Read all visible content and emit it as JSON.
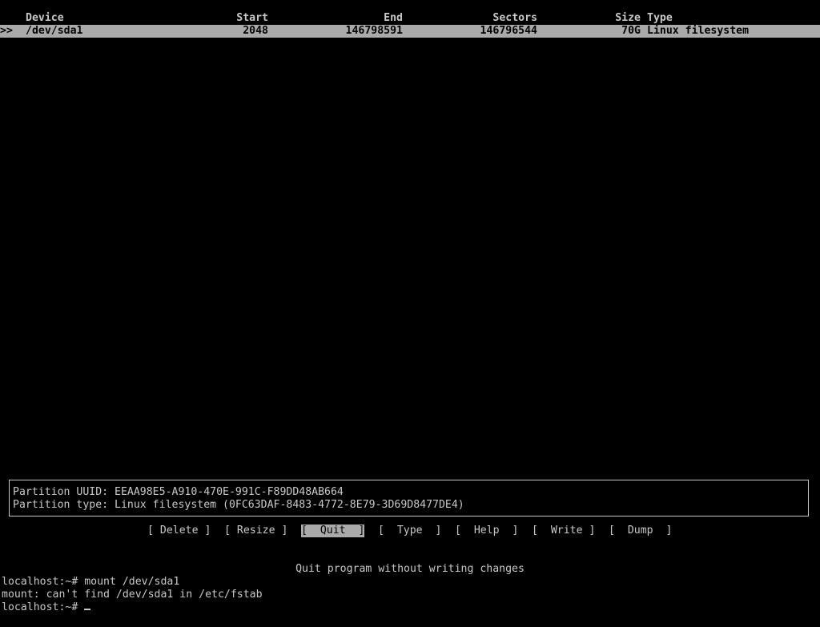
{
  "table": {
    "headers": {
      "device": "Device",
      "start": "Start",
      "end": "End",
      "sectors": "Sectors",
      "size": "Size",
      "type": "Type"
    },
    "rows": [
      {
        "marker": ">>",
        "device": "/dev/sda1",
        "start": "2048",
        "end": "146798591",
        "sectors": "146796544",
        "size": "70G",
        "type": "Linux filesystem"
      }
    ]
  },
  "info": {
    "uuid_label": "Partition UUID:",
    "uuid_value": "EEAA98E5-A910-470E-991C-F89DD48AB664",
    "type_label": "Partition type:",
    "type_value": "Linux filesystem (0FC63DAF-8483-4772-8E79-3D69D8477DE4)"
  },
  "menu": {
    "delete": "[ Delete ]",
    "resize": "[ Resize ]",
    "quit": "[  Quit  ]",
    "type": "[  Type  ]",
    "help": "[  Help  ]",
    "write": "[  Write ]",
    "dump": "[  Dump  ]",
    "selected": "quit"
  },
  "hint": "Quit program without writing changes",
  "terminal": {
    "line1": "localhost:~# mount /dev/sda1",
    "line2": "mount: can't find /dev/sda1 in /etc/fstab",
    "prompt": "localhost:~# "
  },
  "colors": {
    "background": "#000000",
    "foreground": "#c8c8c8",
    "highlight": "#aaaaaa"
  }
}
